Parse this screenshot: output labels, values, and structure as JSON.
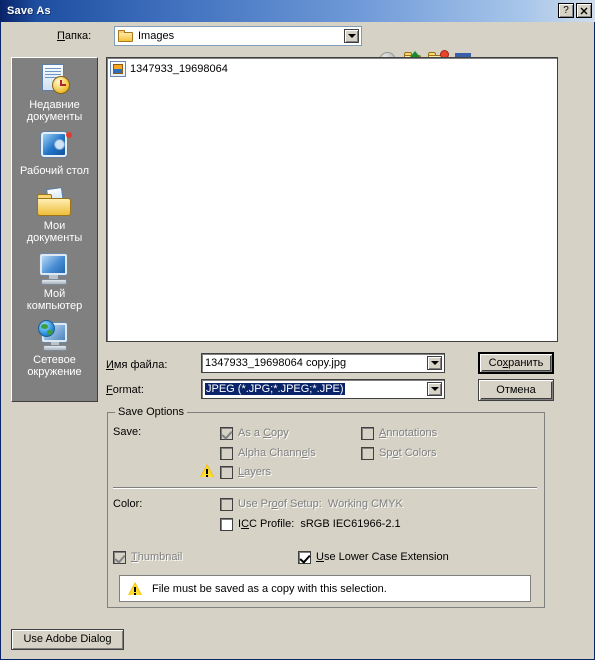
{
  "window": {
    "title": "Save As",
    "help_button": "?",
    "close_button": "✕"
  },
  "lookin": {
    "label": "Папка:",
    "value": "Images",
    "toolbar": [
      {
        "name": "back-button",
        "tip": "Back"
      },
      {
        "name": "up-one-level-button",
        "tip": "Up One Level"
      },
      {
        "name": "create-new-folder-button",
        "tip": "Create New Folder"
      },
      {
        "name": "views-button",
        "tip": "Views"
      }
    ]
  },
  "places": [
    {
      "label_line1": "Недавние",
      "label_line2": "документы",
      "icon": "recent-documents-icon"
    },
    {
      "label_line1": "Рабочий стол",
      "label_line2": "",
      "icon": "desktop-icon"
    },
    {
      "label_line1": "Мои",
      "label_line2": "документы",
      "icon": "my-documents-icon"
    },
    {
      "label_line1": "Мой",
      "label_line2": "компьютер",
      "icon": "my-computer-icon"
    },
    {
      "label_line1": "Сетевое",
      "label_line2": "окружение",
      "icon": "network-places-icon"
    }
  ],
  "filelist": {
    "items": [
      {
        "name": "1347933_19698064",
        "icon": "image-file-icon"
      }
    ]
  },
  "filename": {
    "label": "Имя файла:",
    "label_accel": "И",
    "value": "1347933_19698064 copy.jpg"
  },
  "format": {
    "label": "Format:",
    "label_accel": "F",
    "value": "JPEG (*.JPG;*.JPEG;*.JPE)"
  },
  "buttons": {
    "save": "Сохранить",
    "cancel": "Отмена",
    "use_adobe_dialog": "Use Adobe Dialog"
  },
  "save_options": {
    "legend": "Save Options",
    "save_label": "Save:",
    "color_label": "Color:",
    "checkboxes": [
      {
        "id": "as-a-copy",
        "label": "As a Copy",
        "checked": true,
        "disabled": true,
        "accel": "C"
      },
      {
        "id": "annotations",
        "label": "Annotations",
        "checked": false,
        "disabled": true,
        "accel": "A"
      },
      {
        "id": "alpha-channels",
        "label": "Alpha Channels",
        "checked": false,
        "disabled": true,
        "accel": "l"
      },
      {
        "id": "spot-colors",
        "label": "Spot Colors",
        "checked": false,
        "disabled": true,
        "accel": "o"
      },
      {
        "id": "layers",
        "label": "Layers",
        "checked": false,
        "disabled": true,
        "accel": "L",
        "warning": true
      },
      {
        "id": "use-proof-setup",
        "label": "Use Proof Setup:  Working CMYK",
        "checked": false,
        "disabled": true,
        "accel": "o"
      },
      {
        "id": "icc-profile",
        "label": "ICC Profile:  sRGB IEC61966-2.1",
        "checked": false,
        "disabled": false,
        "accel": "C"
      },
      {
        "id": "thumbnail",
        "label": "Thumbnail",
        "checked": true,
        "disabled": true,
        "accel": "T"
      },
      {
        "id": "use-lower-case-extension",
        "label": "Use Lower Case Extension",
        "checked": true,
        "disabled": false,
        "accel": "U"
      }
    ],
    "warning_message": "File must be saved as a copy with this selection."
  },
  "colors": {
    "title_bar_dark": "#0a246a",
    "title_bar_light": "#a8c6ea",
    "dialog_face": "#d6d2c6",
    "places_bar": "#808080",
    "selection": "#0a246a",
    "warning_yellow": "#ffdd33",
    "disabled_text": "#808080"
  }
}
